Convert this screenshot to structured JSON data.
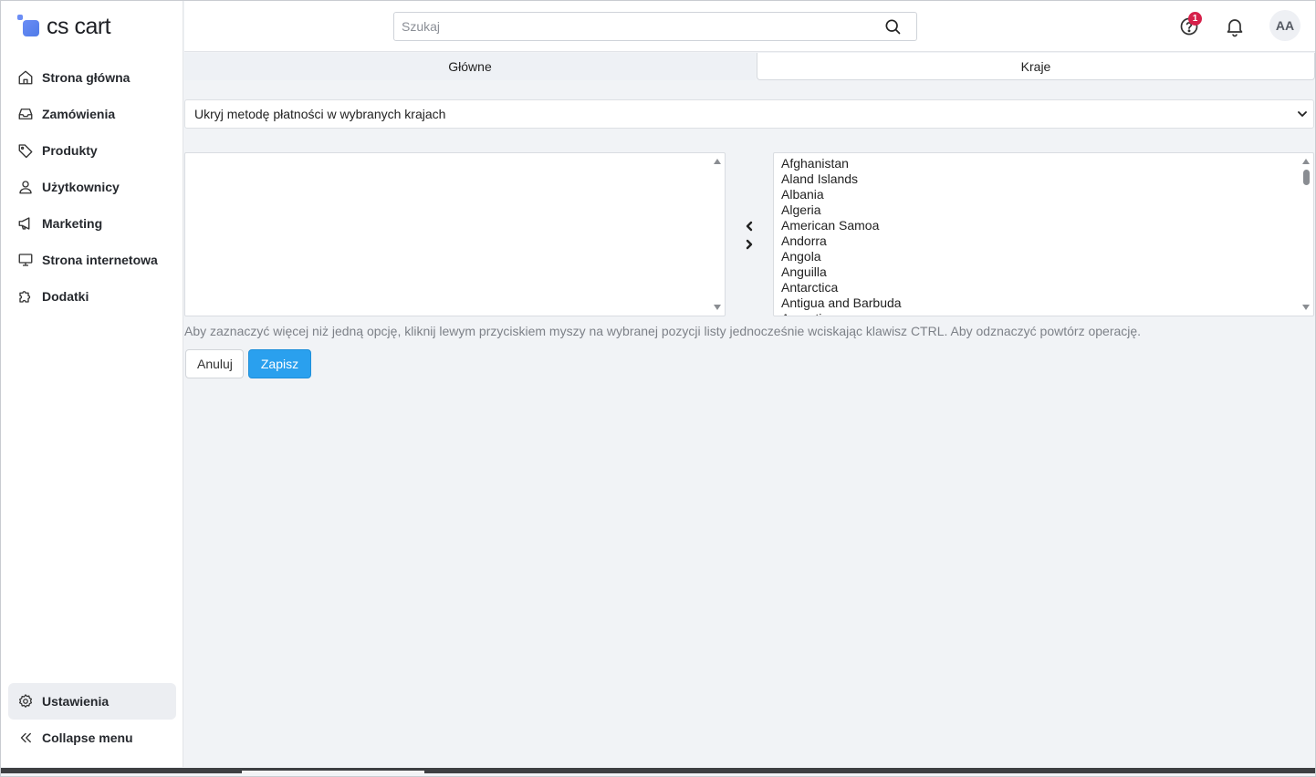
{
  "app": {
    "logo_text": "cs cart"
  },
  "sidebar": {
    "items": [
      {
        "label": "Strona główna",
        "icon": "home-icon"
      },
      {
        "label": "Zamówienia",
        "icon": "inbox-icon"
      },
      {
        "label": "Produkty",
        "icon": "tag-icon"
      },
      {
        "label": "Użytkownicy",
        "icon": "user-icon"
      },
      {
        "label": "Marketing",
        "icon": "megaphone-icon"
      },
      {
        "label": "Strona internetowa",
        "icon": "monitor-icon"
      },
      {
        "label": "Dodatki",
        "icon": "puzzle-icon"
      }
    ],
    "settings_label": "Ustawienia",
    "collapse_label": "Collapse menu"
  },
  "header": {
    "search_placeholder": "Szukaj",
    "notification_count": "1",
    "avatar_initials": "AA"
  },
  "tabs": {
    "main_label": "Główne",
    "countries_label": "Kraje",
    "active": "countries"
  },
  "form": {
    "visibility_select_value": "Ukryj metodę płatności w wybranych krajach",
    "selected_countries": [],
    "available_countries": [
      "Afghanistan",
      "Aland Islands",
      "Albania",
      "Algeria",
      "American Samoa",
      "Andorra",
      "Angola",
      "Anguilla",
      "Antarctica",
      "Antigua and Barbuda",
      "Argentina"
    ],
    "hint": "Aby zaznaczyć więcej niż jedną opcję, kliknij lewym przyciskiem myszy na wybranej pozycji listy jednocześnie wciskając klawisz CTRL. Aby odznaczyć powtórz operację.",
    "cancel_label": "Anuluj",
    "save_label": "Zapisz"
  },
  "colors": {
    "primary": "#2aa0ee",
    "badge": "#d6204a",
    "sidebar_active": "#eceef2"
  }
}
